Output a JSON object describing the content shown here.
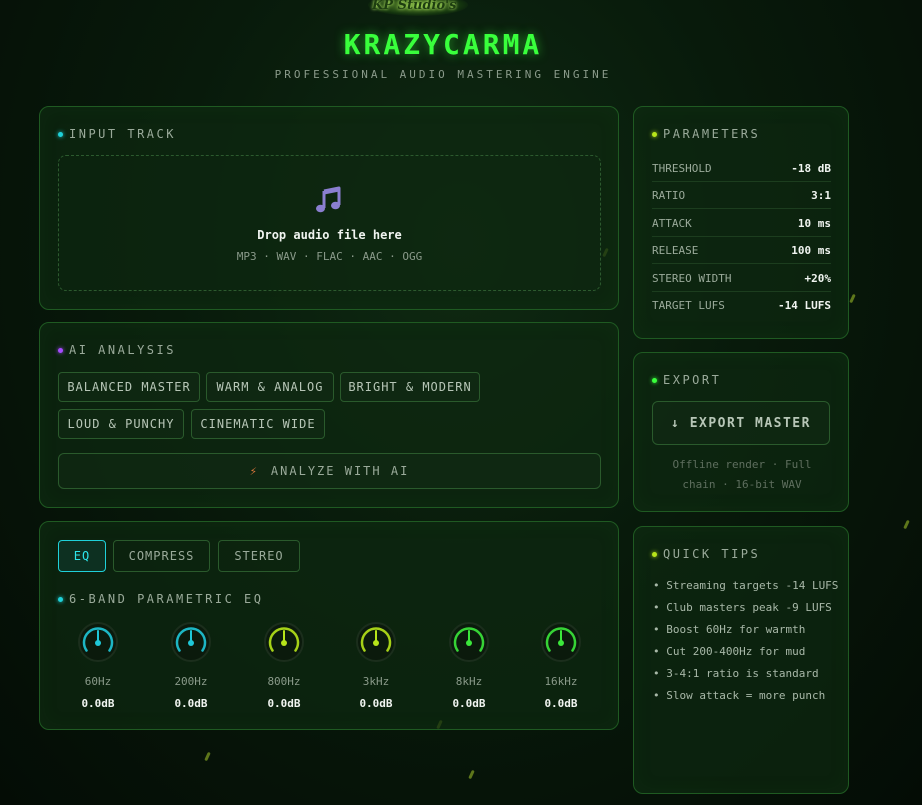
{
  "brand": {
    "logo_text": "KP Studio's",
    "title": "KRAZYCARMA",
    "subtitle": "PROFESSIONAL AUDIO MASTERING ENGINE"
  },
  "input_track": {
    "title": "INPUT TRACK",
    "icon": "music-note-icon",
    "drop_title": "Drop audio file here",
    "formats": "MP3 · WAV · FLAC · AAC · OGG"
  },
  "ai_analysis": {
    "title": "AI ANALYSIS",
    "presets": [
      "BALANCED MASTER",
      "WARM & ANALOG",
      "BRIGHT & MODERN",
      "LOUD & PUNCHY",
      "CINEMATIC WIDE"
    ],
    "analyze_label": "ANALYZE WITH AI",
    "analyze_icon": "lightning-bolt-icon"
  },
  "processing": {
    "tabs": [
      "EQ",
      "COMPRESS",
      "STEREO"
    ],
    "active_tab": "EQ",
    "eq_title": "6-BAND PARAMETRIC EQ",
    "bands": [
      {
        "label": "60Hz",
        "value": "0.0dB",
        "color": "#1fc8d8"
      },
      {
        "label": "200Hz",
        "value": "0.0dB",
        "color": "#1fc8d8"
      },
      {
        "label": "800Hz",
        "value": "0.0dB",
        "color": "#b7e51a"
      },
      {
        "label": "3kHz",
        "value": "0.0dB",
        "color": "#b7e51a"
      },
      {
        "label": "8kHz",
        "value": "0.0dB",
        "color": "#3be83b"
      },
      {
        "label": "16kHz",
        "value": "0.0dB",
        "color": "#3be83b"
      }
    ]
  },
  "parameters": {
    "title": "PARAMETERS",
    "rows": [
      {
        "name": "THRESHOLD",
        "value": "-18 dB"
      },
      {
        "name": "RATIO",
        "value": "3:1"
      },
      {
        "name": "ATTACK",
        "value": "10 ms"
      },
      {
        "name": "RELEASE",
        "value": "100 ms"
      },
      {
        "name": "STEREO WIDTH",
        "value": "+20%"
      },
      {
        "name": "TARGET LUFS",
        "value": "-14 LUFS"
      }
    ]
  },
  "export": {
    "title": "EXPORT",
    "button_label": "↓ EXPORT MASTER",
    "note": "Offline render · Full chain · 16-bit WAV"
  },
  "tips": {
    "title": "QUICK TIPS",
    "items": [
      "• Streaming targets -14 LUFS",
      "• Club masters peak -9 LUFS",
      "• Boost 60Hz for warmth",
      "• Cut 200-400Hz for mud",
      "• 3-4:1 ratio is standard",
      "• Slow attack = more punch"
    ]
  },
  "colors": {
    "accent": "#39ff3c",
    "cyan": "#1fd1d9",
    "lime": "#b7e51a",
    "purple": "#a64cff"
  }
}
